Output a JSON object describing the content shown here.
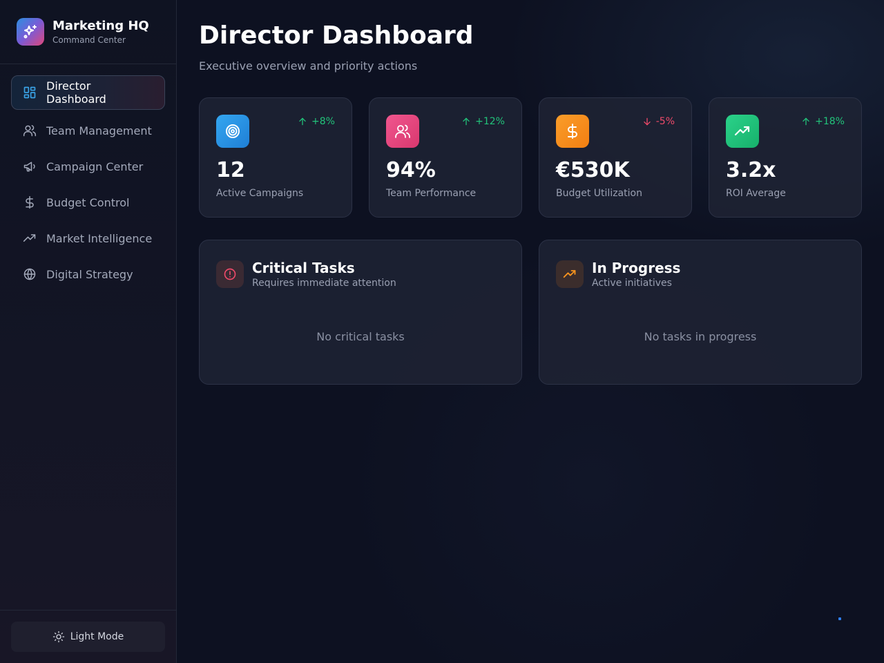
{
  "brand": {
    "title": "Marketing HQ",
    "subtitle": "Command Center",
    "icon": "sparkles-icon"
  },
  "sidebar": {
    "items": [
      {
        "label": "Director Dashboard",
        "icon": "grid-icon",
        "active": true
      },
      {
        "label": "Team Management",
        "icon": "users-icon",
        "active": false
      },
      {
        "label": "Campaign Center",
        "icon": "megaphone-icon",
        "active": false
      },
      {
        "label": "Budget Control",
        "icon": "dollar-icon",
        "active": false
      },
      {
        "label": "Market Intelligence",
        "icon": "trending-up-icon",
        "active": false
      },
      {
        "label": "Digital Strategy",
        "icon": "globe-icon",
        "active": false
      }
    ],
    "footer": {
      "light_mode_label": "Light Mode",
      "icon": "sun-icon"
    }
  },
  "header": {
    "title": "Director Dashboard",
    "subtitle": "Executive overview and priority actions"
  },
  "stats": [
    {
      "value": "12",
      "label": "Active Campaigns",
      "change": "+8%",
      "direction": "up",
      "icon": "target-icon",
      "color": "#2b8fe0"
    },
    {
      "value": "94%",
      "label": "Team Performance",
      "change": "+12%",
      "direction": "up",
      "icon": "users-icon",
      "color": "#ec4a84"
    },
    {
      "value": "€530K",
      "label": "Budget Utilization",
      "change": "-5%",
      "direction": "down",
      "icon": "dollar-icon",
      "color": "#f7931e"
    },
    {
      "value": "3.2x",
      "label": "ROI Average",
      "change": "+18%",
      "direction": "up",
      "icon": "trending-up-icon",
      "color": "#22c37a"
    }
  ],
  "panels": [
    {
      "title": "Critical Tasks",
      "subtitle": "Requires immediate attention",
      "empty": "No critical tasks",
      "icon": "alert-circle-icon",
      "color": "#ef4a6a"
    },
    {
      "title": "In Progress",
      "subtitle": "Active initiatives",
      "empty": "No tasks in progress",
      "icon": "trending-up-icon",
      "color": "#f7931e"
    }
  ],
  "colors": {
    "accent_blue": "#2b8fe0",
    "positive": "#22c37a",
    "negative": "#ef4a6a"
  }
}
